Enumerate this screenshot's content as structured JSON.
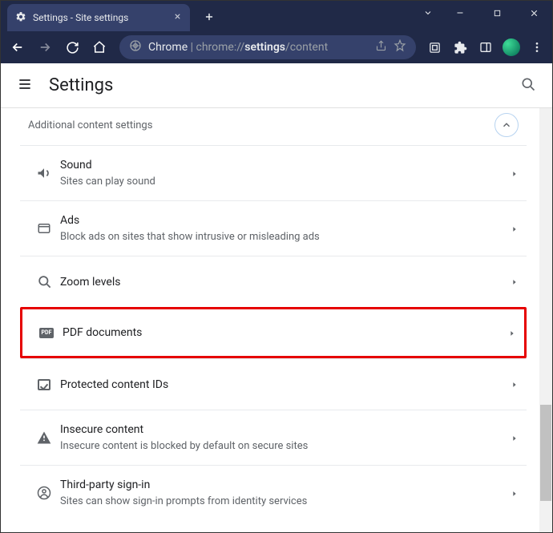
{
  "window": {
    "tab_title": "Settings - Site settings"
  },
  "omnibox": {
    "prefix": "Chrome",
    "url_dim1": "chrome://",
    "url_bold": "settings",
    "url_dim2": "/content"
  },
  "header": {
    "title": "Settings"
  },
  "section": {
    "label": "Additional content settings"
  },
  "rows": [
    {
      "id": "sound",
      "title": "Sound",
      "sub": "Sites can play sound"
    },
    {
      "id": "ads",
      "title": "Ads",
      "sub": "Block ads on sites that show intrusive or misleading ads"
    },
    {
      "id": "zoom",
      "title": "Zoom levels",
      "sub": ""
    },
    {
      "id": "pdf",
      "title": "PDF documents",
      "sub": ""
    },
    {
      "id": "protected",
      "title": "Protected content IDs",
      "sub": ""
    },
    {
      "id": "insecure",
      "title": "Insecure content",
      "sub": "Insecure content is blocked by default on secure sites"
    },
    {
      "id": "third-party",
      "title": "Third-party sign-in",
      "sub": "Sites can show sign-in prompts from identity services"
    }
  ],
  "pdf_badge": "PDF"
}
